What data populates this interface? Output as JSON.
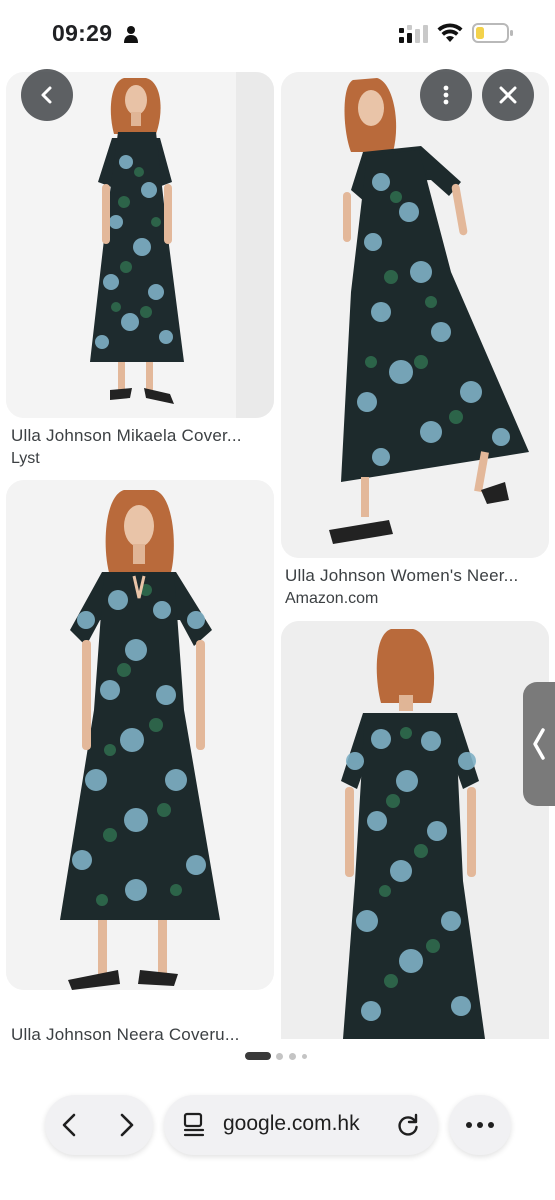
{
  "status_bar": {
    "time": "09:29",
    "icons": [
      "person-icon",
      "signal-icon",
      "wifi-icon",
      "battery-icon"
    ]
  },
  "results": [
    {
      "title": "Ulla Johnson Mikaela Cover...",
      "source": "Lyst"
    },
    {
      "title": "Ulla Johnson Women's Neer...",
      "source": "Amazon.com"
    },
    {
      "title": "Ulla Johnson Neera Coveru..."
    },
    {
      "title": ""
    }
  ],
  "overlay": {
    "icons": [
      "chevron-left-icon",
      "more-vertical-icon",
      "close-icon",
      "chevron-left-icon"
    ]
  },
  "pagination": {
    "count": 4,
    "active_index": 0
  },
  "browser": {
    "url": "google.com.hk",
    "icons": [
      "back-arrow-icon",
      "forward-arrow-icon",
      "page-icon",
      "reload-icon",
      "more-horizontal-icon"
    ]
  },
  "colors": {
    "dress_dark": "#1d2a2c",
    "print_blue": "#7fb1c6",
    "print_green": "#2f6a4d",
    "tile_bg": "#f2f2f2",
    "button_bg": "#3c4043"
  }
}
